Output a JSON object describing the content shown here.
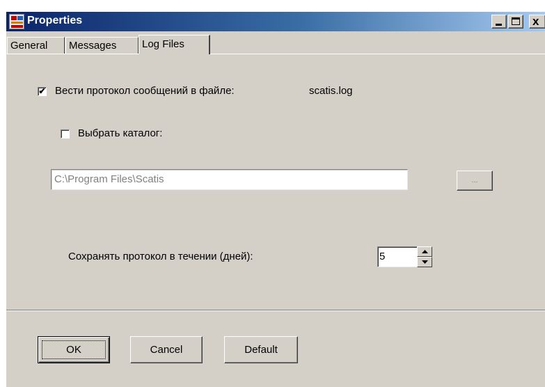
{
  "window": {
    "title": "Properties",
    "minimize_glyph": "_",
    "maximize_glyph": "□",
    "close_glyph": "x"
  },
  "tabs": [
    {
      "label": "General",
      "active": false
    },
    {
      "label": "Messages",
      "active": false
    },
    {
      "label": "Log Files",
      "active": true
    }
  ],
  "log_files": {
    "enable_log_label": "Вести протокол сообщений в файле:",
    "enable_log_checked": true,
    "log_filename": "scatis.log",
    "choose_dir_label": "Выбрать каталог:",
    "choose_dir_checked": false,
    "directory_path": "C:\\Program Files\\Scatis",
    "browse_label": "...",
    "keep_days_label": "Сохранять протокол в течении (дней):",
    "keep_days_value": "5"
  },
  "buttons": {
    "ok": "OK",
    "cancel": "Cancel",
    "default": "Default"
  },
  "check_mark": "✔",
  "colors": {
    "face": "#d4d0c8",
    "title_start": "#0a246a",
    "title_end": "#a6caf0",
    "disabled_text": "#808080"
  }
}
